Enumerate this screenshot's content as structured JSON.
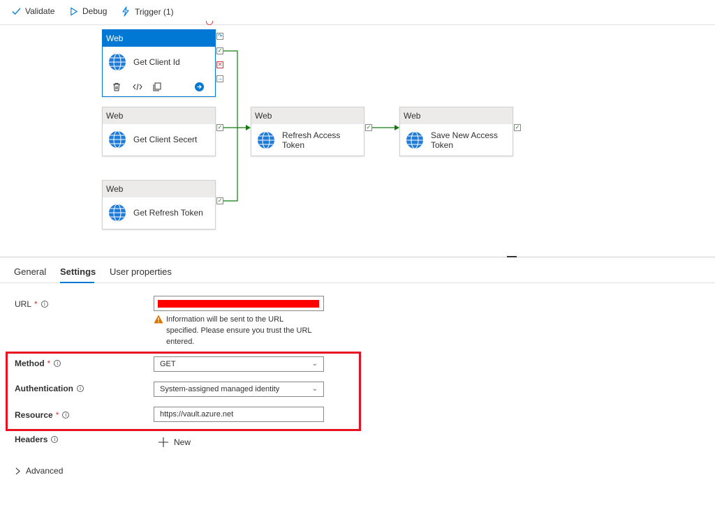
{
  "toolbar": {
    "validate_label": "Validate",
    "debug_label": "Debug",
    "trigger_label": "Trigger (1)"
  },
  "nodes": {
    "get_client_id": {
      "type": "Web",
      "label": "Get Client Id"
    },
    "get_client_secret": {
      "type": "Web",
      "label": "Get Client Secert"
    },
    "get_refresh_token": {
      "type": "Web",
      "label": "Get Refresh Token"
    },
    "refresh_access_token": {
      "type": "Web",
      "label_line1": "Refresh Access",
      "label_line2": "Token"
    },
    "save_new_access_token": {
      "type": "Web",
      "label_line1": "Save New Access",
      "label_line2": "Token"
    }
  },
  "colors": {
    "accent": "#0078d4",
    "success": "#107c10",
    "error": "#d13438",
    "warning": "#d47500",
    "highlight_box": "#e81123"
  },
  "tabs": {
    "general": "General",
    "settings": "Settings",
    "user_properties": "User properties"
  },
  "settings": {
    "url": {
      "label": "URL",
      "required_mark": "*",
      "warning_line1": "Information will be sent to the URL",
      "warning_line2": "specified. Please ensure you trust the URL",
      "warning_line3": "entered."
    },
    "method": {
      "label": "Method",
      "required_mark": "*",
      "value": "GET"
    },
    "authentication": {
      "label": "Authentication",
      "value": "System-assigned managed identity"
    },
    "resource": {
      "label": "Resource",
      "required_mark": "*",
      "value": "https://vault.azure.net"
    },
    "headers": {
      "label": "Headers",
      "new_label": "New"
    },
    "advanced_label": "Advanced"
  },
  "icons": {
    "validate": "check-icon",
    "debug": "play-outline-icon",
    "trigger": "lightning-icon",
    "activity": "globe-icon",
    "info": "info-circle-icon",
    "warning": "warning-triangle-icon",
    "dropdown": "chevron-down-icon",
    "add": "plus-icon",
    "expand": "chevron-right-icon"
  }
}
